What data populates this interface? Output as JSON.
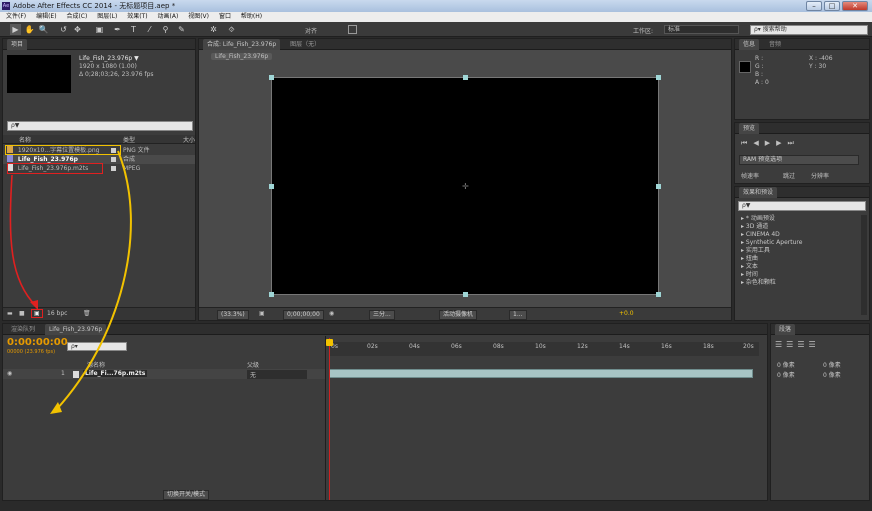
{
  "window": {
    "title": "Adobe After Effects CC 2014 - 无标题项目.aep *",
    "app_icon": "Ae",
    "minimize": "–",
    "maximize": "□",
    "close": "✕"
  },
  "menu": [
    "文件(F)",
    "编辑(E)",
    "合成(C)",
    "图层(L)",
    "效果(T)",
    "动画(A)",
    "视图(V)",
    "窗口",
    "帮助(H)"
  ],
  "toolbar": {
    "tools": [
      "▶",
      "✋",
      "🔍",
      "↺",
      "✥",
      "▣",
      "✒",
      "T",
      "⁄",
      "⚲",
      "✎",
      "✲",
      "⯑"
    ],
    "snap_label": "对齐",
    "workspace_label": "工作区:",
    "workspace_value": "标准",
    "search_placeholder": "搜索帮助"
  },
  "project": {
    "tab": "项目",
    "item_name": "Life_Fish_23.976p ▼",
    "item_line1": "1920 x 1080 (1.00)",
    "item_line2": "Δ 0;28;03;26, 23.976 fps",
    "search": "ρ▼",
    "col_name": "名称",
    "col_type": "类型",
    "col_size": "大小",
    "rows": [
      {
        "name": "1920x10...字幕位置模板.png",
        "type": "PNG 文件"
      },
      {
        "name": "Life_Fish_23.976p",
        "type": "合成"
      },
      {
        "name": "Life_Fish_23.976p.m2ts",
        "type": "MPEG"
      }
    ],
    "bpc": "16 bpc"
  },
  "composition": {
    "tab": "合成: Life_Fish_23.976p",
    "tab2": "图层（无）",
    "subtab": "Life_Fish_23.976p",
    "zoom": "(33.3%)",
    "timecode": "0;00;00;00",
    "quality": "三分...",
    "camera": "活动摄像机",
    "views": "1...",
    "exposure": "+0.0"
  },
  "info": {
    "tab1": "信息",
    "tab2": "音频",
    "r": "R :",
    "g": "G :",
    "b": "B :",
    "a": "A : 0",
    "x": "X : -406",
    "y": "Y : 30"
  },
  "preview": {
    "tab": "预览",
    "ram_option": "RAM 预览选项",
    "frame_rate": "帧速率",
    "skip": "跳过",
    "resolution": "分辨率"
  },
  "effects": {
    "tab": "效果和预设",
    "search": "ρ▼",
    "items": [
      "* 动画预设",
      "3D 通道",
      "CINEMA 4D",
      "Synthetic Aperture",
      "实用工具",
      "扭曲",
      "文本",
      "时间",
      "杂色和颗粒"
    ]
  },
  "timeline": {
    "tab_render": "渲染队列",
    "tab_comp": "Life_Fish_23.976p",
    "timecode": "0:00:00:00",
    "frames": "00000 (23.976 fps)",
    "col_source": "源名称",
    "col_parent": "父级",
    "layer_num": "1",
    "layer_name": "Life_Fi...76p.m2ts",
    "parent_value": "无",
    "ruler": [
      "0s",
      "02s",
      "04s",
      "06s",
      "08s",
      "10s",
      "12s",
      "14s",
      "16s",
      "18s",
      "20s"
    ],
    "toggle_label": "切换开关/模式"
  },
  "paragraph": {
    "tab": "段落",
    "indent1": "0 像素",
    "indent2": "0 像素",
    "indent3": "0 像素",
    "indent4": "0 像素"
  },
  "colors": {
    "accent_yellow": "#f2c200",
    "annotation_red": "#e02020",
    "timecode_orange": "#e69a00"
  }
}
